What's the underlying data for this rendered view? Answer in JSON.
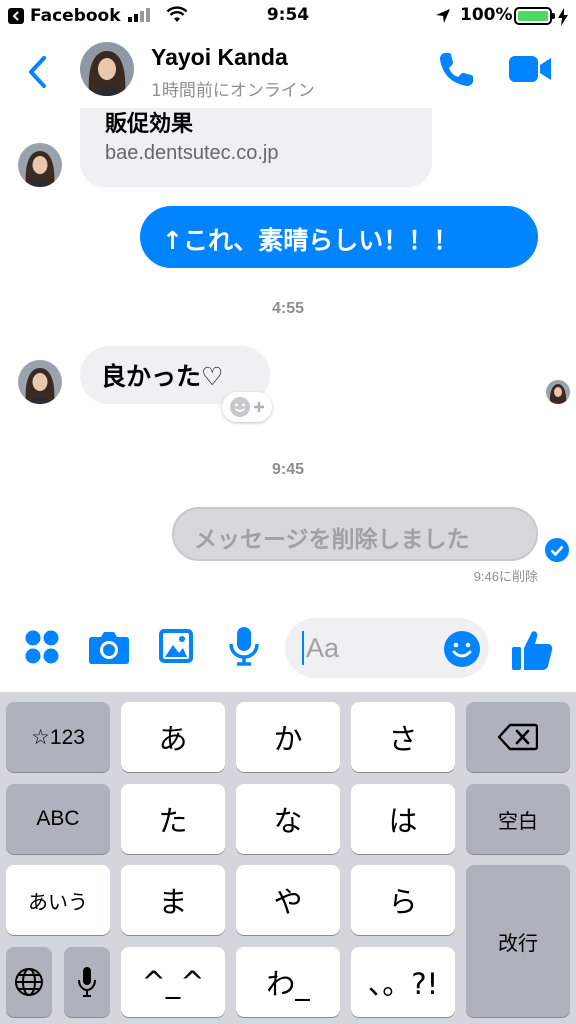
{
  "status_bar": {
    "back_app": "Facebook",
    "time": "9:54",
    "battery": "100%"
  },
  "header": {
    "name": "Yayoi Kanda",
    "presence": "1時間前にオンライン"
  },
  "messages": {
    "link_title": "販促効果",
    "link_domain": "bae.dentsutec.co.jp",
    "outgoing": "↑これ、素晴らしい！！！",
    "timestamp_1": "4:55",
    "incoming": "良かった♡",
    "timestamp_2": "9:45",
    "deleted": "メッセージを削除しました",
    "deleted_note": "9:46に削除"
  },
  "composer": {
    "placeholder": "Aa"
  },
  "keyboard": {
    "rows": [
      [
        "☆123",
        "あ",
        "か",
        "さ",
        "⌫"
      ],
      [
        "ABC",
        "た",
        "な",
        "は",
        "空白"
      ],
      [
        "あいう",
        "ま",
        "や",
        "ら",
        "改行"
      ],
      [
        "🌐",
        "🎤",
        "^_^",
        "わ_",
        "、。?!"
      ]
    ]
  },
  "colors": {
    "messenger_blue": "#0084ff",
    "incoming_bubble": "#f0f0f2",
    "battery_green": "#4cd964"
  }
}
